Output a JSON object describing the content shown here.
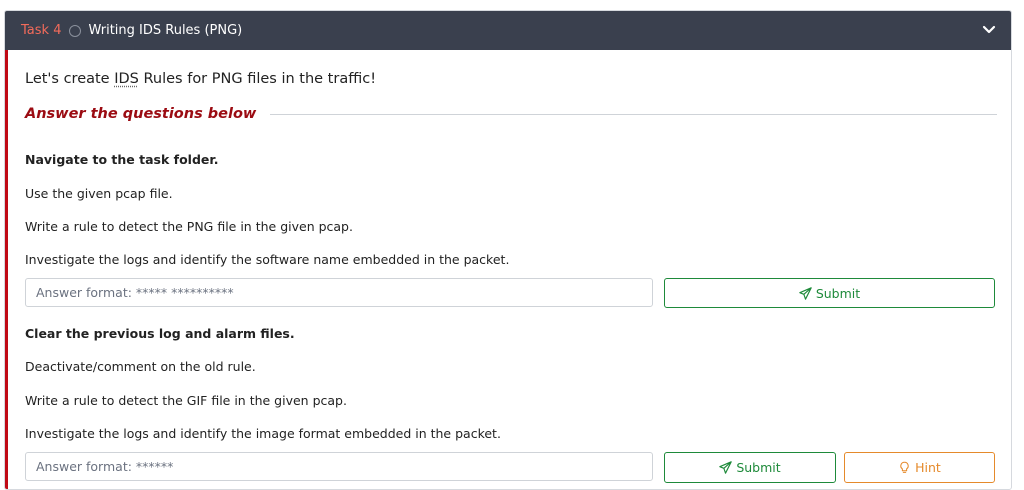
{
  "task": {
    "number": "Task 4",
    "title": "Writing IDS Rules (PNG)"
  },
  "intro": {
    "before": "Let's create ",
    "ids": "IDS",
    "after": " Rules for PNG files in the traffic!"
  },
  "answer_heading": "Answer the questions below",
  "question1": {
    "lines": [
      "Navigate to the task folder.",
      "Use the given pcap file.",
      "Write a rule to detect the PNG file in the given pcap.",
      "Investigate the logs and identify the software name embedded in the packet."
    ],
    "placeholder": "Answer format: ***** **********",
    "submit_label": "Submit"
  },
  "question2": {
    "lines": [
      "Clear the previous log and alarm files.",
      "Deactivate/comment on the old rule.",
      "Write a rule to detect the GIF file in the given pcap.",
      "Investigate the logs and identify the image format embedded in the packet."
    ],
    "placeholder": "Answer format: ******",
    "submit_label": "Submit",
    "hint_label": "Hint"
  },
  "colors": {
    "header_bg": "#3a404e",
    "accent_red": "#c00a16",
    "submit_green": "#1e8a3a",
    "hint_orange": "#e58a2b"
  },
  "icons": [
    "circle-status-icon",
    "chevron-down-icon",
    "paper-plane-icon",
    "lightbulb-icon"
  ]
}
